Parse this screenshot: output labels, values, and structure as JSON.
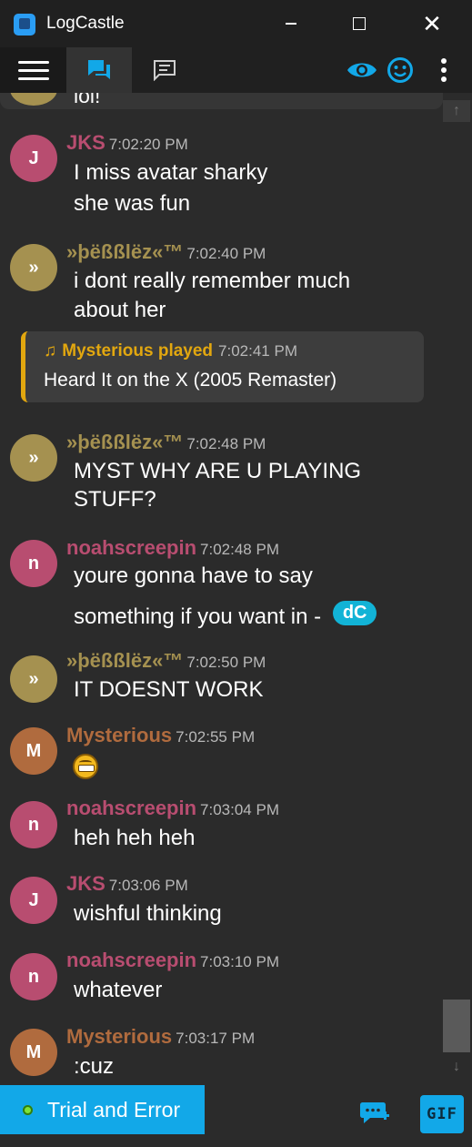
{
  "window": {
    "title": "LogCastle"
  },
  "toolbar": {
    "menu_icon": "hamburger-menu-icon",
    "tabs": [
      {
        "icon": "chat-bubbles-icon",
        "active": true
      },
      {
        "icon": "message-lines-icon",
        "active": false
      }
    ],
    "right_icons": [
      "eye-icon",
      "smiley-icon",
      "more-vertical-icon"
    ],
    "accent_color": "#12a8e8"
  },
  "previous_message": {
    "text": "lol!"
  },
  "messages": [
    {
      "initial": "J",
      "user": "JKS",
      "time": "7:02:20 PM",
      "lines": [
        "I miss avatar sharky",
        "she was fun"
      ],
      "color": "#b84d70"
    },
    {
      "initial": "»",
      "user": "»þëßßlëz«™",
      "time": "7:02:40 PM",
      "lines": [
        "i dont really remember much",
        "about her"
      ],
      "color": "#a59150"
    },
    {
      "initial": "»",
      "user": "»þëßßlëz«™",
      "time": "7:02:48 PM",
      "lines": [
        "MYST WHY ARE U PLAYING",
        "STUFF?"
      ],
      "color": "#a59150"
    },
    {
      "initial": "n",
      "user": "noahscreepin",
      "time": "7:02:48 PM",
      "lines": [
        "youre gonna have to say",
        "something if you want in - "
      ],
      "badge": "dC",
      "color": "#b84d70"
    },
    {
      "initial": "»",
      "user": "»þëßßlëz«™",
      "time": "7:02:50 PM",
      "lines": [
        "IT DOESNT WORK"
      ],
      "color": "#a59150"
    },
    {
      "initial": "M",
      "user": "Mysterious",
      "time": "7:02:55 PM",
      "lines": [],
      "emoji": "grimace-emoji",
      "color": "#b06b3e"
    },
    {
      "initial": "n",
      "user": "noahscreepin",
      "time": "7:03:04 PM",
      "lines": [
        "heh heh heh"
      ],
      "color": "#b84d70"
    },
    {
      "initial": "J",
      "user": "JKS",
      "time": "7:03:06 PM",
      "lines": [
        "wishful thinking"
      ],
      "color": "#b84d70"
    },
    {
      "initial": "n",
      "user": "noahscreepin",
      "time": "7:03:10 PM",
      "lines": [
        "whatever"
      ],
      "color": "#b84d70"
    },
    {
      "initial": "M",
      "user": "Mysterious",
      "time": "7:03:17 PM",
      "lines": [
        ":cuz"
      ],
      "color": "#b06b3e"
    }
  ],
  "music_notice": {
    "icon": "music-note-icon",
    "user": "Mysterious played",
    "time": "7:02:41 PM",
    "song": "Heard It on the X (2005 Remaster)",
    "color": "#e2a70f"
  },
  "bottom": {
    "channel": "Trial and Error",
    "status_color": "#7ee337",
    "new_chat_icon": "new-chat-icon",
    "gif_label": "GIF"
  }
}
